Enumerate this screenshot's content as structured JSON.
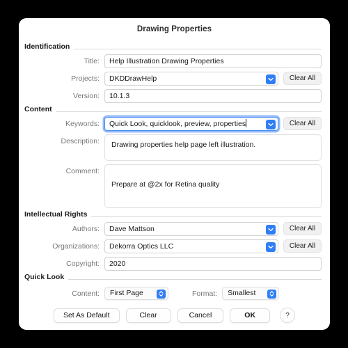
{
  "dialog": {
    "title": "Drawing Properties"
  },
  "sections": {
    "identification": {
      "label": "Identification",
      "title": {
        "label": "Title:",
        "value": "Help Illustration Drawing Properties"
      },
      "projects": {
        "label": "Projects:",
        "value": "DKDDrawHelp",
        "clear_all": "Clear All"
      },
      "version": {
        "label": "Version:",
        "value": "10.1.3"
      }
    },
    "content": {
      "label": "Content",
      "keywords": {
        "label": "Keywords:",
        "value": "Quick Look, quicklook, preview, properties",
        "clear_all": "Clear All"
      },
      "description": {
        "label": "Description:",
        "value": "Drawing properties help page left illustration."
      },
      "comment": {
        "label": "Comment:",
        "value": "Prepare at @2x for Retina quality"
      }
    },
    "intellectual_rights": {
      "label": "Intellectual Rights",
      "authors": {
        "label": "Authors:",
        "value": "Dave Mattson",
        "clear_all": "Clear All"
      },
      "organizations": {
        "label": "Organizations:",
        "value": "Dekorra Optics LLC",
        "clear_all": "Clear All"
      },
      "copyright": {
        "label": "Copyright:",
        "value": "2020"
      }
    },
    "quick_look": {
      "label": "Quick Look",
      "content": {
        "label": "Content:",
        "value": "First Page"
      },
      "format": {
        "label": "Format:",
        "value": "Smallest"
      }
    }
  },
  "buttons": {
    "set_as_default": "Set As Default",
    "clear": "Clear",
    "cancel": "Cancel",
    "ok": "OK",
    "help": "?"
  },
  "colors": {
    "accent": "#2f7ef5",
    "focus_ring": "#4a90f0",
    "label_gray": "#767676",
    "backdrop": "#000000"
  }
}
